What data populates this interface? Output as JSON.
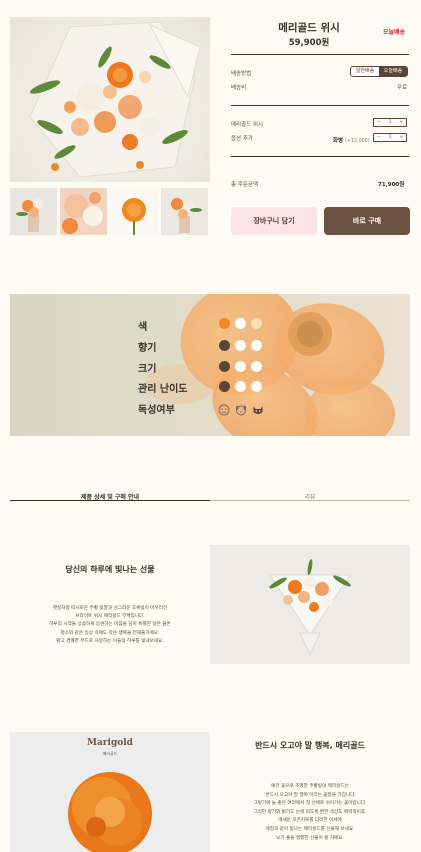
{
  "product": {
    "title": "메리골드 위시",
    "price": "59,900원",
    "badge": "오늘배송"
  },
  "shipping": {
    "method_label": "배송방법",
    "options": [
      "일반배송",
      "오늘배송"
    ],
    "selected_option": "오늘배송",
    "fee_label": "배송비",
    "fee_value": "무료"
  },
  "options": {
    "product_label": "메리골드 위시",
    "product_qty": "1",
    "addon_label": "옵션 추가",
    "addon_name": "화병",
    "addon_price": "(+12,000)",
    "addon_qty": "1"
  },
  "total": {
    "label": "총 주문금액",
    "value": "71,900원"
  },
  "buttons": {
    "cart": "장바구니 담기",
    "buy": "바로 구매"
  },
  "attributes": [
    {
      "label": "색"
    },
    {
      "label": "향기"
    },
    {
      "label": "크기"
    },
    {
      "label": "관리 난이도"
    },
    {
      "label": "독성여부"
    }
  ],
  "tabs": [
    "제품 상세 및 구매 안내",
    "리뷰"
  ],
  "section2": {
    "title": "당신의 하루에 빛나는 선물",
    "lines": [
      "햇살처럼 따사로운 주황 빛깔과 싱그러운 초록빛이 어우러진",
      "브라이트 위시 메리골드 부케입니다.",
      "하루의 시작을 상큼하게 응원하는 마음을 담아 특별한 날은 물론",
      "평소와 같은 일상 속에도 작은 행복을 전해줄거예요.",
      "밝고 경쾌한 부드로 사랑하는 이들의 하루를 빛내보세요."
    ]
  },
  "section3": {
    "mg_title": "Marigold",
    "mg_sub": "메리골드",
    "title": "반드시 오고야 말 행복, 메리골드",
    "lines": [
      "예전 꽃으로 조명한 주황빛의 메리골드는",
      "'반드시 오고야 말 행복'이라는 꽃말을 가집니다.",
      "그렇기에 늘 좋은 여러에서 첫 선에로 쉬어가는 꽃이랍니다.",
      "그리한 향기와 밝기도 눈에 띄도록 뻔한 색상도 매력적이죠.",
      "메세운 모은지로를 더러한 이세에",
      "애정과 같이 빛나는 메리골드를 선물해 보세요.",
      "보기 좋을 행했한 선물이 될 거예요."
    ]
  },
  "colors": {
    "accent_brown": "#6b5140",
    "accent_pink": "#fbe3e6",
    "badge_red": "#d8262e",
    "background": "#fdfbf3"
  }
}
